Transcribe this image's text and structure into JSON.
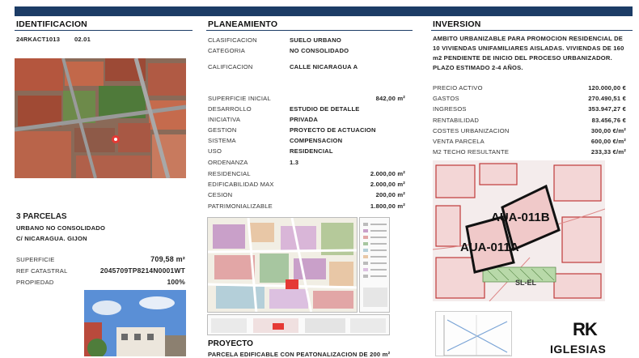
{
  "headers": {
    "identificacion": "IDENTIFICACION",
    "planeamiento": "PLANEAMIENTO",
    "inversion": "INVERSION"
  },
  "ident": {
    "ref": "24RKACT1013",
    "num": "02.01",
    "parcelas_title": "3 PARCELAS",
    "clasif": "URBANO NO CONSOLIDADO",
    "street": "C/ NICARAGUA. GIJON",
    "rows": [
      {
        "label": "SUPERFICIE",
        "value": "709,58 m²"
      },
      {
        "label": "REF CATASTRAL",
        "value": "2045709TP8214N0001WT"
      },
      {
        "label": "PROPIEDAD",
        "value": "100%"
      }
    ]
  },
  "plan": {
    "top_rows": [
      {
        "label": "CLASIFICACION",
        "value": "SUELO URBANO"
      },
      {
        "label": "CATEGORIA",
        "value": "NO CONSOLIDADO"
      }
    ],
    "calif": {
      "label": "CALIFICACION",
      "value": "CALLE NICARAGUA A"
    },
    "superficie": {
      "label": "SUPERFICIE INICIAL",
      "value": "842,00 m²"
    },
    "text_rows": [
      {
        "label": "DESARROLLO",
        "value": "ESTUDIO DE DETALLE"
      },
      {
        "label": "INICIATIVA",
        "value": "PRIVADA"
      },
      {
        "label": "GESTION",
        "value": "PROYECTO DE ACTUACION"
      },
      {
        "label": "SISTEMA",
        "value": "COMPENSACION"
      },
      {
        "label": "USO",
        "value": "RESIDENCIAL"
      },
      {
        "label": "ORDENANZA",
        "value": "1.3"
      }
    ],
    "num_rows": [
      {
        "label": "RESIDENCIAL",
        "value": "2.000,00 m²"
      },
      {
        "label": "EDIFICABILIDAD MAX",
        "value": "2.000,00 m²"
      },
      {
        "label": "CESION",
        "value": "200,00 m²"
      },
      {
        "label": "PATRIMONIALIZABLE",
        "value": "1.800,00 m²"
      }
    ],
    "proyecto_title": "PROYECTO",
    "proyecto_text": "PARCELA EDIFICABLE CON PEATONALIZACION DE 200 m²"
  },
  "inv": {
    "description": [
      "AMBITO URBANIZABLE PARA PROMOCION RESIDENCIAL DE",
      "10 VIVIENDAS UNIFAMILIARES AISLADAS. VIVIENDAS DE 160",
      "m2 PENDIENTE DE INICIO DEL PROCESO URBANIZADOR.",
      "PLAZO ESTIMADO 2-4 AÑOS."
    ],
    "rows": [
      {
        "label": "PRECIO ACTIVO",
        "value": "120.000,00 €"
      },
      {
        "label": "GASTOS",
        "value": "270.490,51 €"
      },
      {
        "label": "INGRESOS",
        "value": "353.947,27 €"
      },
      {
        "label": "RENTABILIDAD",
        "value": "83.456,76 €"
      },
      {
        "label": "COSTES URBANIZACION",
        "value": "300,00 €/m²"
      },
      {
        "label": "VENTA PARCELA",
        "value": "600,00 €/m²"
      },
      {
        "label": "M2 TECHO RESULTANTE",
        "value": "233,33 €/m²"
      }
    ],
    "map_labels": {
      "a": "AUA-011A",
      "b": "AUA-011B",
      "c": "SL-EL"
    }
  },
  "brand": {
    "logo": "RK",
    "name": "IGLESIAS"
  },
  "colors": {
    "accent": "#1c3c66"
  }
}
